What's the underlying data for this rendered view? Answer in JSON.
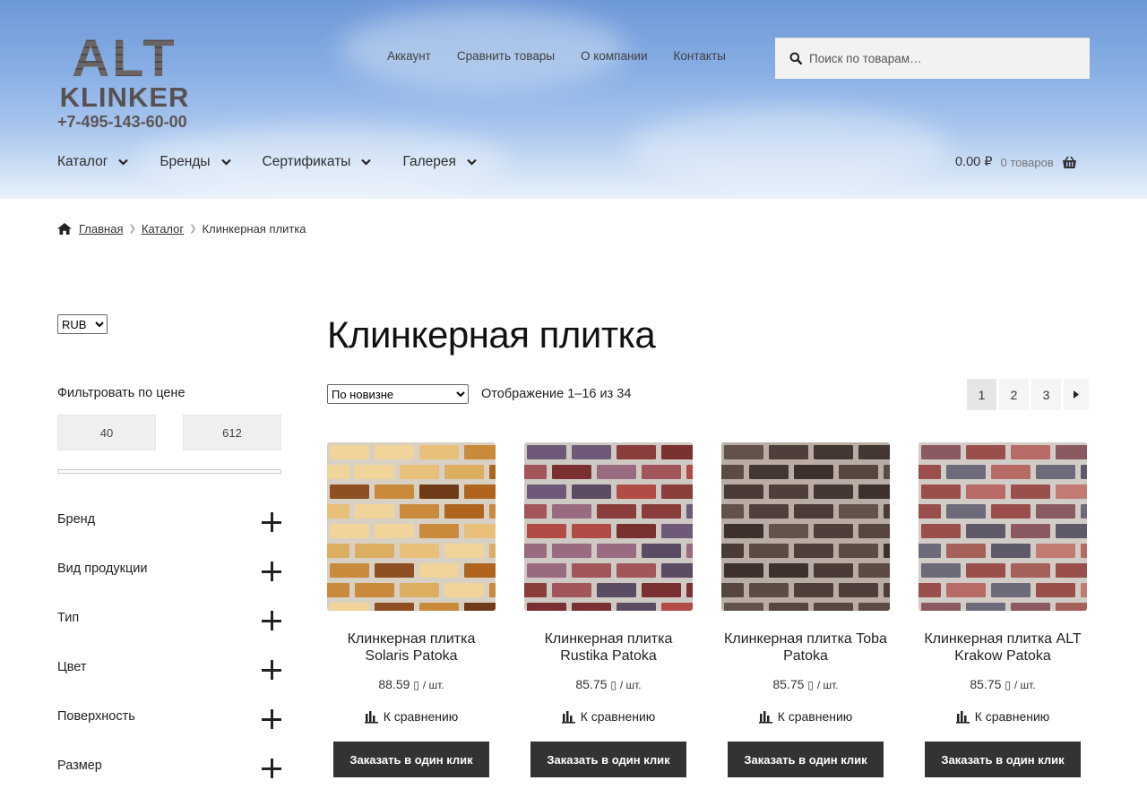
{
  "header": {
    "logo": {
      "brand_top": "ALT",
      "brand_bottom": "KLINKER",
      "phone": "+7-495-143-60-00"
    },
    "top_nav": [
      "Аккаунт",
      "Сравнить товары",
      "О компании",
      "Контакты"
    ],
    "search": {
      "placeholder": "Поиск по товарам…",
      "value": ""
    },
    "main_nav": [
      "Каталог",
      "Бренды",
      "Сертификаты",
      "Галерея"
    ],
    "cart": {
      "amount": "0.00 ₽",
      "count": "0 товаров"
    }
  },
  "breadcrumb": {
    "home": "Главная",
    "catalog": "Каталог",
    "current": "Клинкерная плитка"
  },
  "sidebar": {
    "currency": {
      "selected": "RUB"
    },
    "price_filter": {
      "title": "Фильтровать по цене",
      "min": "40",
      "max": "612"
    },
    "facets": [
      "Бренд",
      "Вид продукции",
      "Тип",
      "Цвет",
      "Поверхность",
      "Размер"
    ]
  },
  "main": {
    "title": "Клинкерная плитка",
    "sort": {
      "selected": "По новизне"
    },
    "result_count": "Отображение 1–16 из 34",
    "pagination": [
      "1",
      "2",
      "3"
    ],
    "products": [
      {
        "name": "Клинкерная плитка Solaris Patoka",
        "price": "88.59",
        "currency_glyph": "▯",
        "unit": "/ шт.",
        "compare": "К сравнению",
        "buy": "Заказать в один клик"
      },
      {
        "name": "Клинкерная плитка Rustika Patoka",
        "price": "85.75",
        "currency_glyph": "▯",
        "unit": "/ шт.",
        "compare": "К сравнению",
        "buy": "Заказать в один клик"
      },
      {
        "name": "Клинкерная плитка Toba Patoka",
        "price": "85.75",
        "currency_glyph": "▯",
        "unit": "/ шт.",
        "compare": "К сравнению",
        "buy": "Заказать в один клик"
      },
      {
        "name": "Клинкерная плитка ALT Krakow Patoka",
        "price": "85.75",
        "currency_glyph": "▯",
        "unit": "/ шт.",
        "compare": "К сравнению",
        "buy": "Заказать в один клик"
      }
    ]
  },
  "colors": {
    "header_sky": "#87aee4",
    "button_dark": "#333333",
    "page_bg": "#ffffff"
  }
}
